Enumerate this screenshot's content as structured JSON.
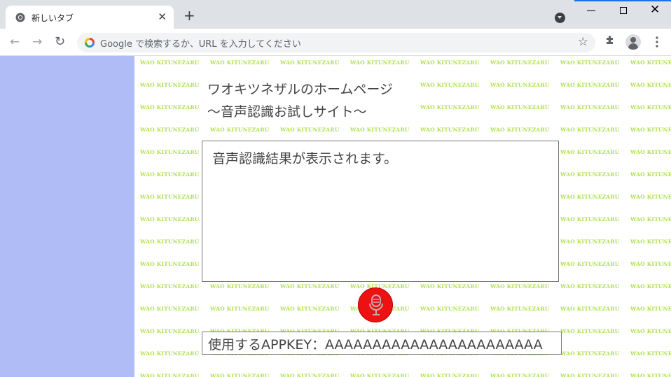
{
  "browser": {
    "tab_title": "新しいタブ",
    "omnibox_placeholder": "Google で検索するか、URL を入力してください"
  },
  "page": {
    "title_line1": "ワオキツネザルのホームページ",
    "title_line2": "～音声認識お試しサイト～",
    "result_text": "音声認識結果が表示されます。",
    "appkey_text": "使用するAPPKEY：AAAAAAAAAAAAAAAAAAAAAAA",
    "background_pattern_text": "WAO KITUNEZARU"
  },
  "colors": {
    "sidebar": "#b0bcf5",
    "pattern_text": "#aee04a",
    "mic_button": "#ee1111"
  },
  "icons": {
    "mic_button": "microphone-icon"
  }
}
